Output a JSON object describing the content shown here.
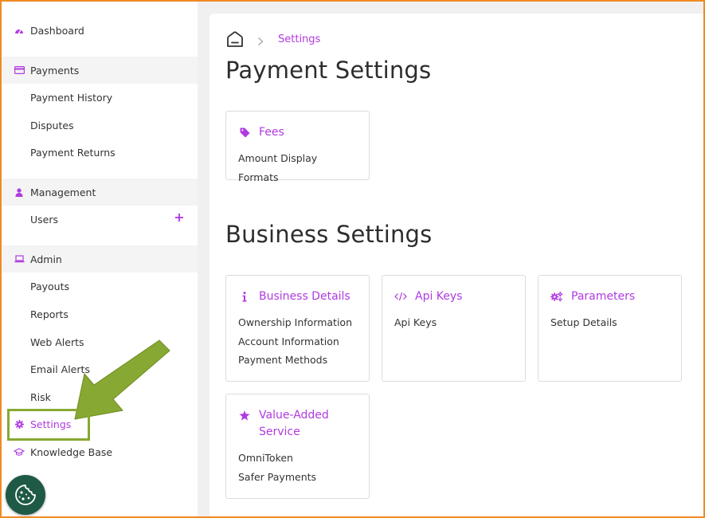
{
  "sidebar": {
    "items": [
      {
        "label": "Dashboard",
        "icon": "dashboard-icon"
      },
      {
        "label": "Payments",
        "icon": "credit-card-icon"
      },
      {
        "label": "Payment History"
      },
      {
        "label": "Disputes"
      },
      {
        "label": "Payment Returns"
      },
      {
        "label": "Management",
        "icon": "user-icon"
      },
      {
        "label": "Users"
      },
      {
        "label": "Admin",
        "icon": "laptop-icon"
      },
      {
        "label": "Payouts"
      },
      {
        "label": "Reports"
      },
      {
        "label": "Web Alerts"
      },
      {
        "label": "Email Alerts"
      },
      {
        "label": "Risk"
      },
      {
        "label": "Settings",
        "icon": "gear-icon"
      },
      {
        "label": "Knowledge Base",
        "icon": "graduation-cap-icon"
      }
    ],
    "users_add": "+"
  },
  "breadcrumb": {
    "current": "Settings"
  },
  "sections": [
    {
      "title": "Payment Settings"
    },
    {
      "title": "Business Settings"
    }
  ],
  "cards": [
    {
      "title": "Fees",
      "icon": "tag-icon",
      "links": [
        "Amount Display Formats"
      ]
    },
    {
      "title": "Business Details",
      "icon": "info-icon",
      "links": [
        "Ownership Information",
        "Account Information",
        "Payment Methods"
      ]
    },
    {
      "title": "Api Keys",
      "icon": "code-icon",
      "links": [
        "Api Keys"
      ]
    },
    {
      "title": "Parameters",
      "icon": "gears-icon",
      "links": [
        "Setup Details"
      ]
    },
    {
      "title": "Value-Added Service",
      "icon": "star-icon",
      "links": [
        "OmniToken",
        "Safer Payments"
      ]
    }
  ],
  "colors": {
    "accent": "#b03ae0",
    "highlight": "#87a832",
    "frame": "#f08a24",
    "cookie_button": "#1e5a45"
  }
}
